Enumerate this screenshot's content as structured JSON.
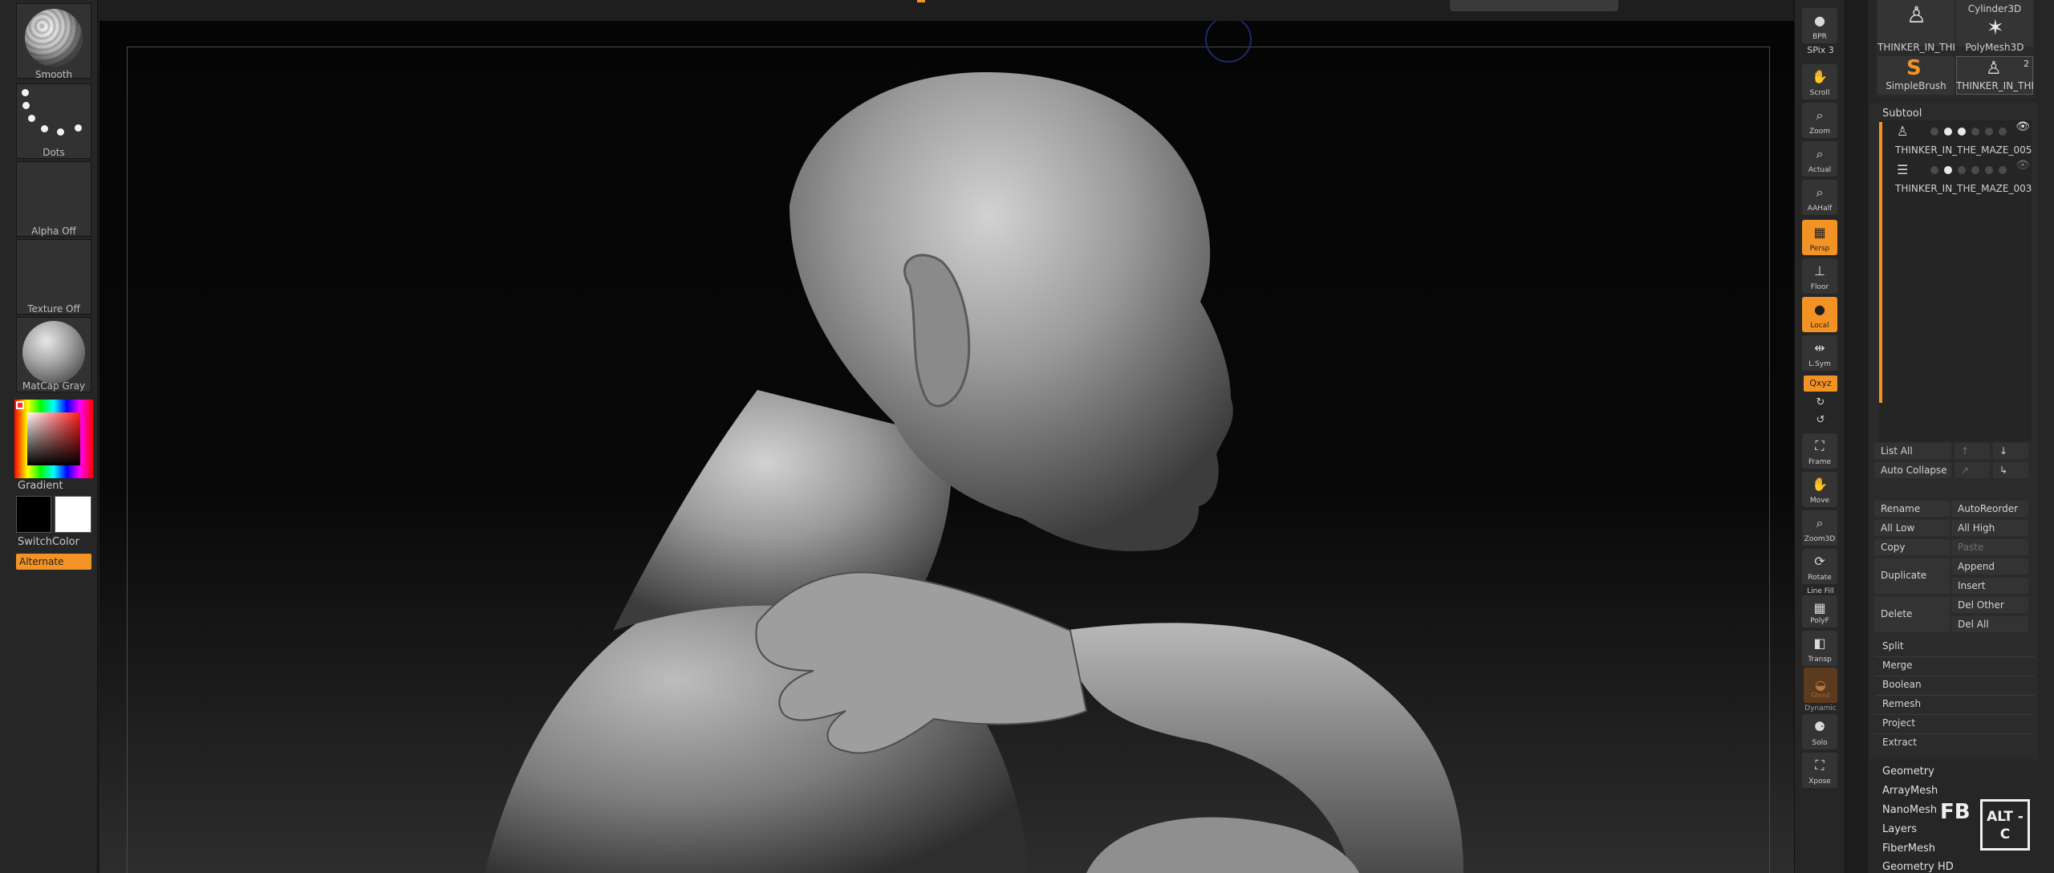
{
  "left_shelf": {
    "brush_label": "Smooth",
    "stroke_label": "Dots",
    "alpha_label": "Alpha Off",
    "texture_label": "Texture Off",
    "material_label": "MatCap Gray",
    "gradient_label": "Gradient",
    "switchcolor_label": "SwitchColor",
    "alternate_label": "Alternate",
    "main_color": "#000000",
    "secondary_color": "#ffffff"
  },
  "right_shelf": {
    "bpr_label": "BPR",
    "spix_label": "SPix 3",
    "scroll_label": "Scroll",
    "zoom_label": "Zoom",
    "actual_label": "Actual",
    "aahalf_label": "AAHalf",
    "persp_label": "Persp",
    "floor_label": "Floor",
    "local_label": "Local",
    "lsym_label": "L.Sym",
    "xyz_label": "Qxyz",
    "frame_label": "Frame",
    "move_label": "Move",
    "zoom3d_label": "Zoom3D",
    "rotate_label": "Rotate",
    "linefill_label": "Line Fill",
    "polyf_label": "PolyF",
    "transp_label": "Transp",
    "ghost_label": "Ghost",
    "dynamic_label": "Dynamic",
    "solo_label": "Solo",
    "xpose_label": "Xpose"
  },
  "tools": {
    "tool1_name": "THINKER_IN_THI",
    "tool2_name": "Cylinder3D",
    "tool3_name": "PolyMesh3D",
    "tool4_name": "SimpleBrush",
    "tool5_name": "THINKER_IN_THI",
    "tool5_badge": "2"
  },
  "subtool": {
    "title": "Subtool",
    "items": [
      {
        "name": "THINKER_IN_THE_MAZE_005"
      },
      {
        "name": "THINKER_IN_THE_MAZE_003"
      }
    ],
    "list_all": "List All",
    "auto_collapse": "Auto Collapse",
    "rename": "Rename",
    "auto_reorder": "AutoReorder",
    "all_low": "All Low",
    "all_high": "All High",
    "copy": "Copy",
    "paste": "Paste",
    "duplicate": "Duplicate",
    "append": "Append",
    "insert": "Insert",
    "delete": "Delete",
    "del_other": "Del Other",
    "del_all": "Del All",
    "split": "Split",
    "merge": "Merge",
    "boolean": "Boolean",
    "remesh": "Remesh",
    "project": "Project",
    "extract": "Extract"
  },
  "tool_menu": {
    "items": [
      "Geometry",
      "ArrayMesh",
      "NanoMesh",
      "Layers",
      "FiberMesh",
      "Geometry HD"
    ]
  },
  "branding": {
    "fb_logo": "FB",
    "altc_logo": "ALT -C"
  },
  "colors": {
    "accent": "#f39326"
  }
}
